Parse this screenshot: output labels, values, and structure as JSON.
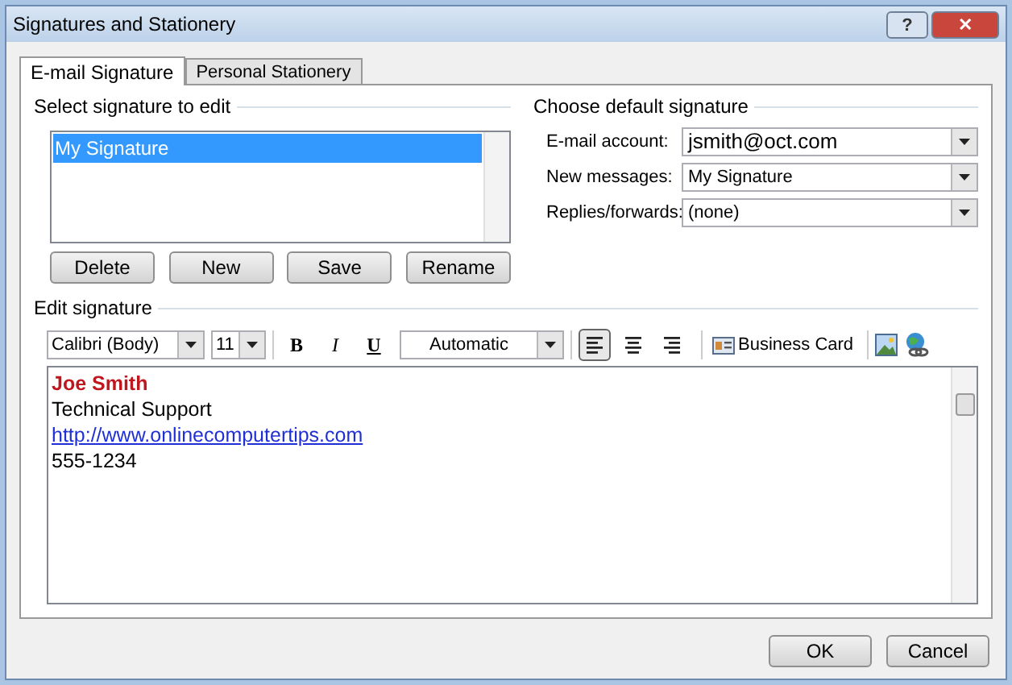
{
  "window": {
    "title": "Signatures and Stationery",
    "buttons": [
      {
        "kind": "help",
        "label": "?"
      },
      {
        "kind": "close",
        "label": "✕"
      }
    ]
  },
  "tabs": [
    {
      "label": "E-mail Signature",
      "selected": true
    },
    {
      "label": "Personal Stationery",
      "selected": false
    }
  ],
  "select_signature": {
    "heading": "Select signature to edit",
    "items": [
      {
        "label": "My Signature",
        "selected": true
      }
    ],
    "buttons": [
      "Delete",
      "New",
      "Save",
      "Rename"
    ]
  },
  "default_signature": {
    "heading": "Choose default signature",
    "fields": [
      {
        "label": "E-mail account:",
        "value": "jsmith@oct.com",
        "emphasis": true
      },
      {
        "label": "New messages:",
        "value": "My Signature",
        "emphasis": false
      },
      {
        "label": "Replies/forwards:",
        "value": "(none)",
        "emphasis": false
      }
    ]
  },
  "edit_signature": {
    "heading": "Edit signature",
    "font": "Calibri (Body)",
    "size": "11",
    "format": [
      {
        "kind": "bold",
        "label": "B",
        "selected": false
      },
      {
        "kind": "italic",
        "label": "I",
        "selected": false
      },
      {
        "kind": "underline",
        "label": "U",
        "selected": false
      }
    ],
    "color_label": "Automatic",
    "align": [
      {
        "kind": "left",
        "selected": true
      },
      {
        "kind": "center",
        "selected": false
      },
      {
        "kind": "right",
        "selected": false
      }
    ],
    "business_card": "Business Card",
    "lines": [
      {
        "kind": "name",
        "text": "Joe Smith"
      },
      {
        "kind": "text",
        "text": "Technical Support"
      },
      {
        "kind": "link",
        "text": "http://www.onlinecomputertips.com"
      },
      {
        "kind": "text",
        "text": "555-1234"
      }
    ]
  },
  "footer_buttons": [
    "OK",
    "Cancel"
  ]
}
